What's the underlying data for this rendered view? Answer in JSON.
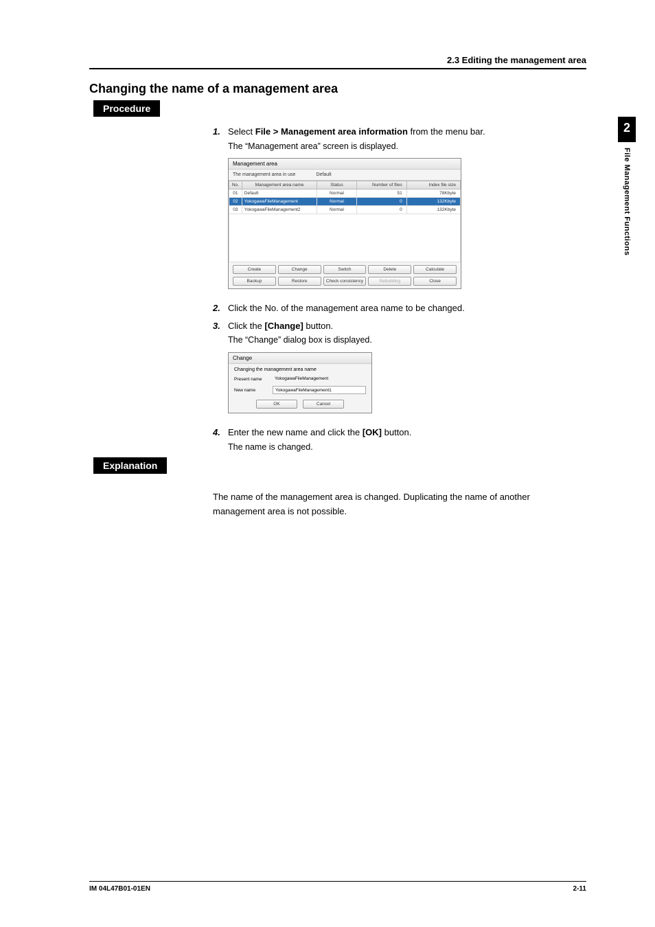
{
  "breadcrumb": "2.3  Editing the management area",
  "section_title": "Changing the name of a management area",
  "label_procedure": "Procedure",
  "label_explanation": "Explanation",
  "side": {
    "chapter_num": "2",
    "chapter_title": "File Management Functions"
  },
  "steps": {
    "s1": {
      "num": "1.",
      "pre": "Select ",
      "bold": "File > Management area information",
      "post": " from the menu bar.",
      "sub": "The “Management area” screen is displayed."
    },
    "s2": {
      "num": "2.",
      "text": "Click the No. of the management area name to be changed."
    },
    "s3": {
      "num": "3.",
      "pre": "Click the ",
      "bold": "[Change]",
      "post": " button.",
      "sub": "The “Change” dialog box is displayed."
    },
    "s4": {
      "num": "4.",
      "pre": "Enter the new name and click the ",
      "bold": "[OK]",
      "post": " button.",
      "sub": "The name is changed."
    }
  },
  "mgmt_window": {
    "title": "Management area",
    "inuse_label": "The management area in use",
    "inuse_value": "Default",
    "headers": {
      "no": "No.",
      "name": "Management area name",
      "status": "Status",
      "files": "Number of files",
      "size": "Index file size"
    },
    "rows": [
      {
        "no": "01",
        "name": "Default",
        "status": "Normal",
        "files": "51",
        "size": "78Kbyte"
      },
      {
        "no": "02",
        "name": "YokogawaFileManagement",
        "status": "Normal",
        "files": "0",
        "size": "132Kbyte"
      },
      {
        "no": "03",
        "name": "YokogawaFileManagement2",
        "status": "Normal",
        "files": "0",
        "size": "132Kbyte"
      }
    ],
    "buttons_row1": {
      "create": "Create",
      "change": "Change",
      "switch": "Switch",
      "delete": "Delete",
      "calculate": "Calculate"
    },
    "buttons_row2": {
      "backup": "Backup",
      "restore": "Restore",
      "check": "Check consistency",
      "rebuild": "Rebuilding",
      "close": "Close"
    }
  },
  "change_dialog": {
    "title": "Change",
    "subtitle": "Changing the management area name",
    "present_label": "Present name",
    "present_value": "YokogawaFileManagement",
    "new_label": "New name",
    "new_value": "YokogawaFileManagement1",
    "ok": "OK",
    "cancel": "Cancel"
  },
  "explanation_text": "The name of the management area is changed. Duplicating the name of another management area is not possible.",
  "footer": {
    "left": "IM 04L47B01-01EN",
    "right": "2-11"
  }
}
